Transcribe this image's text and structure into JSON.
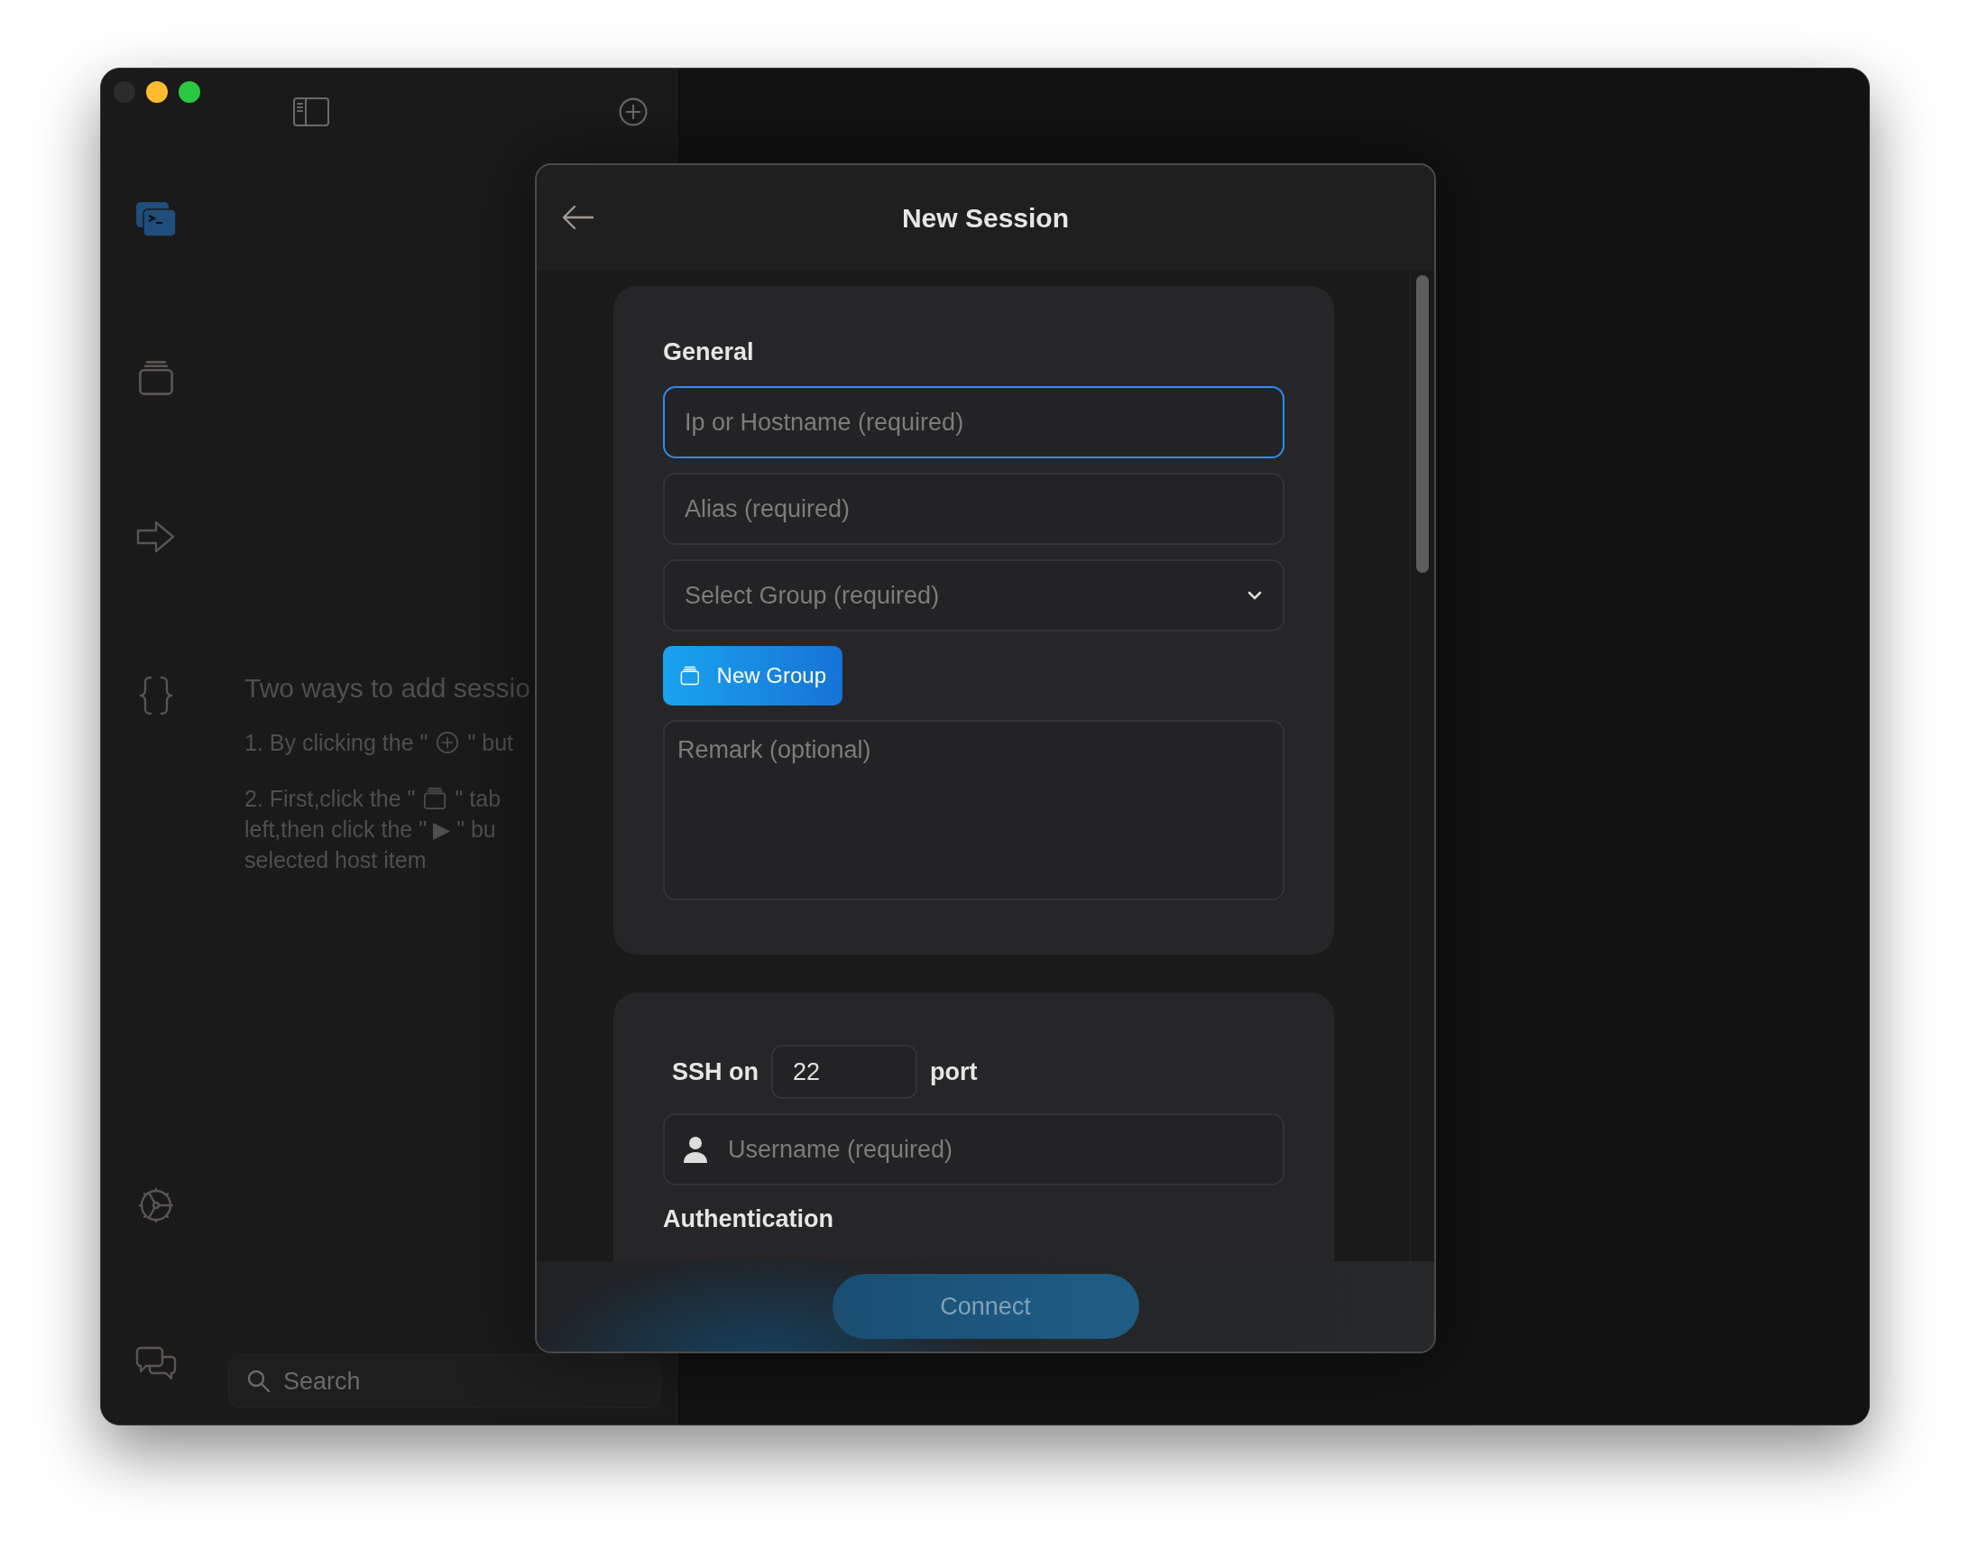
{
  "toolbar": {
    "buttons": [
      {
        "kind": "sidebar_toggle"
      },
      {
        "kind": "add"
      }
    ]
  },
  "rail": {
    "items": [
      {
        "kind": "terminal",
        "selected": true
      },
      {
        "kind": "hosts",
        "selected": false
      },
      {
        "kind": "forward",
        "selected": false
      },
      {
        "kind": "snippets",
        "selected": false
      }
    ],
    "bottom_items": [
      {
        "kind": "settings",
        "selected": false
      },
      {
        "kind": "feedback",
        "selected": false
      }
    ]
  },
  "hint": {
    "title": "Two ways to add sessio",
    "steps": [
      [
        {
          "kind": "text",
          "text": "1. By clicking the \""
        },
        {
          "kind": "circle_plus"
        },
        {
          "kind": "text",
          "text": "\" but"
        }
      ],
      [
        {
          "kind": "text",
          "text": "2. First,click the \""
        },
        {
          "kind": "stack"
        },
        {
          "kind": "text",
          "text": "\" tab"
        }
      ],
      [
        {
          "kind": "text",
          "text": "left,then click the \" ▶ \" bu"
        }
      ],
      [
        {
          "kind": "text",
          "text": "selected host item"
        }
      ]
    ]
  },
  "search": {
    "placeholder": "Search"
  },
  "dialog": {
    "title": "New Session",
    "general": {
      "heading": "General",
      "fields": [
        {
          "kind": "input",
          "placeholder": "Ip or Hostname (required)",
          "focused": true
        },
        {
          "kind": "input",
          "placeholder": "Alias (required)",
          "focused": false
        },
        {
          "kind": "select",
          "placeholder": "Select Group (required)",
          "focused": false
        }
      ],
      "new_group_button": "New Group",
      "remark": {
        "placeholder": "Remark (optional)"
      }
    },
    "ssh": {
      "prefix": "SSH on",
      "port": "22",
      "suffix": "port",
      "username": {
        "placeholder": "Username (required)"
      },
      "auth_heading": "Authentication"
    },
    "connect": {
      "label": "Connect",
      "disabled": true
    }
  }
}
